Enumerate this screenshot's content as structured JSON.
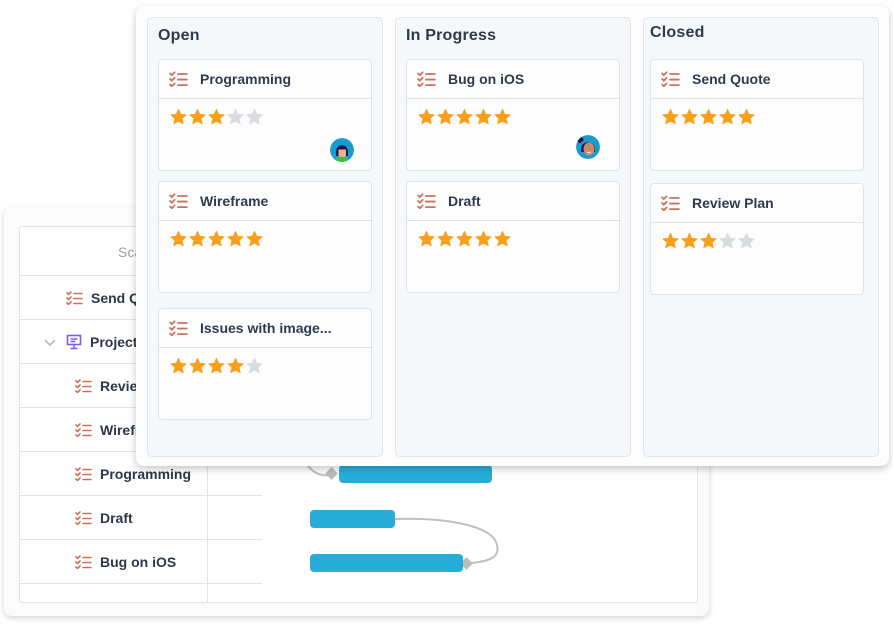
{
  "gantt": {
    "header_label": "Scale",
    "rows": [
      {
        "label": "Send Quote",
        "type": "task"
      },
      {
        "label": "Project",
        "type": "project",
        "expanded": true
      },
      {
        "label": "Review Plan",
        "type": "task"
      },
      {
        "label": "Wireframe",
        "type": "task"
      },
      {
        "label": "Programming",
        "type": "task"
      },
      {
        "label": "Draft",
        "type": "task"
      },
      {
        "label": "Bug on iOS",
        "type": "task"
      }
    ],
    "bar_color": "#26aed8"
  },
  "kanban": {
    "columns": [
      {
        "title": "Open",
        "cards": [
          {
            "title": "Programming",
            "rating": 3,
            "max_rating": 5,
            "avatar": "avatar-woman-dark-hair"
          },
          {
            "title": "Wireframe",
            "rating": 5,
            "max_rating": 5
          },
          {
            "title": "Issues with image...",
            "rating": 4,
            "max_rating": 5
          }
        ]
      },
      {
        "title": "In Progress",
        "cards": [
          {
            "title": "Bug on iOS",
            "rating": 5,
            "max_rating": 5,
            "avatar": "avatar-woman-ponytail"
          },
          {
            "title": "Draft",
            "rating": 5,
            "max_rating": 5
          }
        ]
      },
      {
        "title": "Closed",
        "cards": [
          {
            "title": "Send Quote",
            "rating": 5,
            "max_rating": 5
          },
          {
            "title": "Review Plan",
            "rating": 3,
            "max_rating": 5
          }
        ]
      }
    ],
    "star_on_color": "#f99f1b",
    "star_off_color": "#d8dbe0",
    "task_icon_color": "#c9735a",
    "project_icon_color": "#7b5fe0"
  }
}
